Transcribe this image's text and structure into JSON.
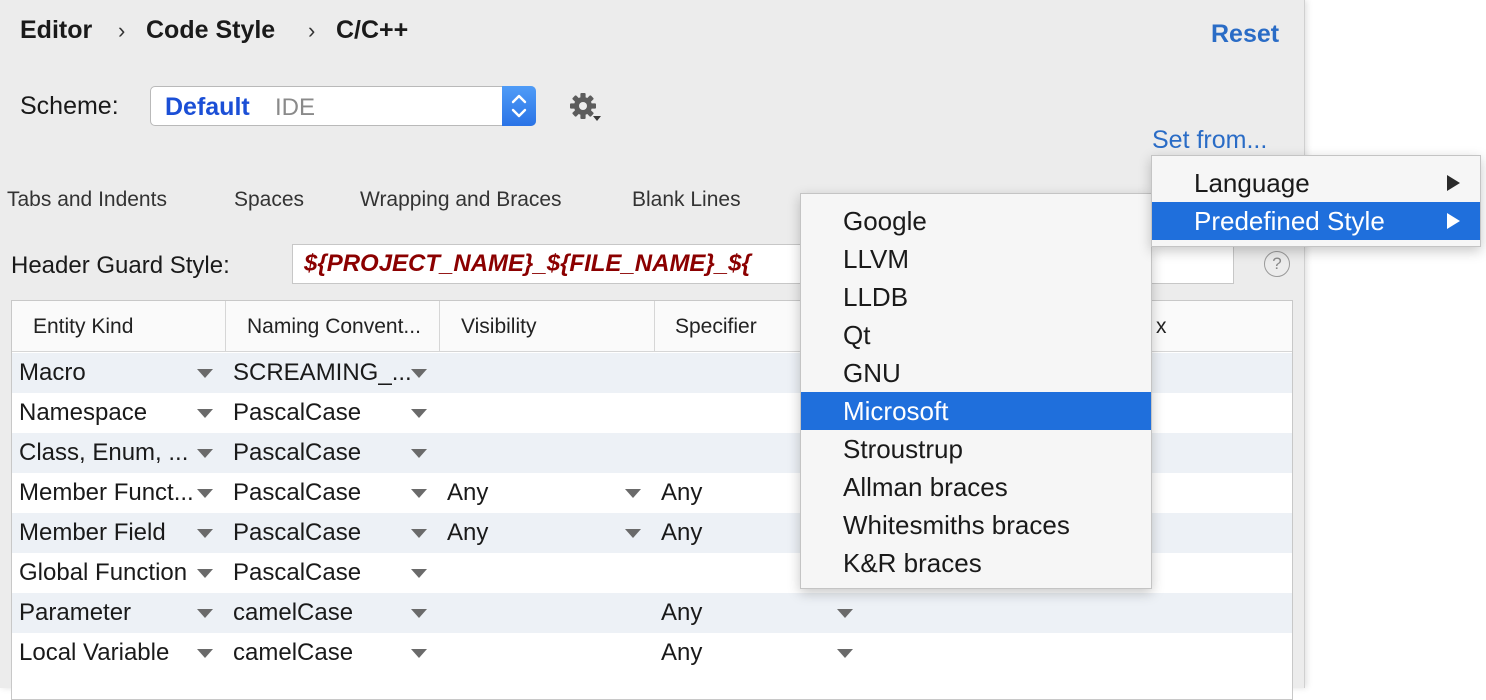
{
  "breadcrumb": [
    "Editor",
    "Code Style",
    "C/C++"
  ],
  "reset_label": "Reset",
  "scheme": {
    "label": "Scheme:",
    "name": "Default",
    "type": "IDE"
  },
  "set_from_label": "Set from...",
  "tabs": [
    "Tabs and Indents",
    "Spaces",
    "Wrapping and Braces",
    "Blank Lines"
  ],
  "header_guard": {
    "label": "Header Guard Style:",
    "value": "${PROJECT_NAME}_${FILE_NAME}_${"
  },
  "table": {
    "columns": [
      "Entity Kind",
      "Naming Convent...",
      "Visibility",
      "Specifier"
    ],
    "hidden_column_suffix": "x",
    "rows": [
      {
        "kind": "Macro",
        "convention": "SCREAMING_...",
        "visibility": "",
        "specifier": ""
      },
      {
        "kind": "Namespace",
        "convention": "PascalCase",
        "visibility": "",
        "specifier": ""
      },
      {
        "kind": "Class, Enum, ...",
        "convention": "PascalCase",
        "visibility": "",
        "specifier": ""
      },
      {
        "kind": "Member Funct...",
        "convention": "PascalCase",
        "visibility": "Any",
        "specifier": "Any"
      },
      {
        "kind": "Member Field",
        "convention": "PascalCase",
        "visibility": "Any",
        "specifier": "Any"
      },
      {
        "kind": "Global Function",
        "convention": "PascalCase",
        "visibility": "",
        "specifier": ""
      },
      {
        "kind": "Parameter",
        "convention": "camelCase",
        "visibility": "",
        "specifier": "Any"
      },
      {
        "kind": "Local Variable",
        "convention": "camelCase",
        "visibility": "",
        "specifier": "Any"
      }
    ]
  },
  "set_from_menu": {
    "items": [
      "Language",
      "Predefined Style"
    ],
    "selected": "Predefined Style"
  },
  "predefined_menu": {
    "items": [
      "Google",
      "LLVM",
      "LLDB",
      "Qt",
      "GNU",
      "Microsoft",
      "Stroustrup",
      "Allman braces",
      "Whitesmiths braces",
      "K&R braces"
    ],
    "selected": "Microsoft"
  },
  "icons": {
    "settings": "gear-icon",
    "help": "help-icon",
    "dropdown": "dropdown-caret-icon",
    "submenu": "submenu-arrow-icon",
    "stepper": "stepper-icon"
  },
  "help_glyph": "?",
  "colors": {
    "accent": "#1f6fdc",
    "link": "#2a6cc6",
    "scheme_name": "#1b4fd6",
    "header_guard": "#8b0000"
  }
}
